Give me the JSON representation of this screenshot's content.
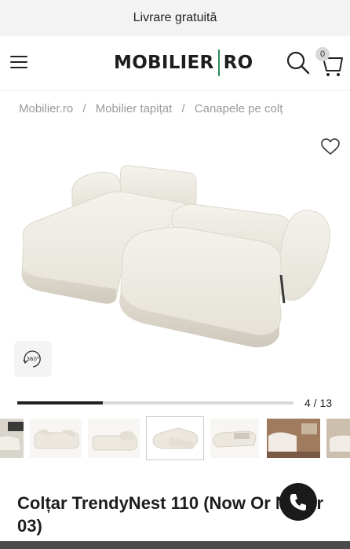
{
  "promo": {
    "text": "Livrare gratuită"
  },
  "header": {
    "logo_left": "MOBILIER",
    "logo_right": "RO",
    "cart_count": "0",
    "accent_color": "#2e8b57"
  },
  "breadcrumb": {
    "items": [
      "Mobilier.ro",
      "Mobilier tapițat",
      "Canapele pe colț"
    ],
    "separator": "/"
  },
  "gallery": {
    "current": 4,
    "total": 13,
    "counter_text": "4 / 13",
    "progress": 0.31,
    "view360_label": "360°"
  },
  "product": {
    "title": "Colțar TrendyNest 110 (Now Or Never 03)"
  },
  "icons": {
    "menu": "hamburger-icon",
    "search": "search-icon",
    "cart": "cart-icon",
    "wishlist": "heart-icon",
    "view360": "rotate-360-icon",
    "call": "phone-icon"
  }
}
